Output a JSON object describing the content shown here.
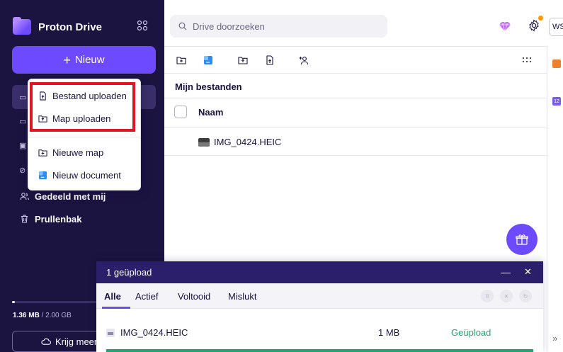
{
  "app": {
    "name": "Proton Drive"
  },
  "sidebar": {
    "new_button_label": "Nieuw",
    "shared_with_me_label": "Gedeeld met mij",
    "trash_label": "Prullenbak",
    "storage": {
      "used": "1.36 MB",
      "separator": " / ",
      "total": "2.00 GB",
      "fraction_used": 0.001
    },
    "get_more_label": "Krijg meer"
  },
  "search": {
    "placeholder": "Drive doorzoeken"
  },
  "user": {
    "initials": "WS"
  },
  "files": {
    "section_title": "Mijn bestanden",
    "column_name": "Naam",
    "items": [
      {
        "name": "IMG_0424.HEIC"
      }
    ]
  },
  "new_menu": {
    "items": [
      {
        "label": "Bestand uploaden"
      },
      {
        "label": "Map uploaden"
      },
      {
        "label": "Nieuwe map"
      },
      {
        "label": "Nieuw document"
      }
    ]
  },
  "upload_panel": {
    "header_title": "1 geüpload",
    "tabs": [
      {
        "label": "Alle"
      },
      {
        "label": "Actief"
      },
      {
        "label": "Voltooid"
      },
      {
        "label": "Mislukt"
      }
    ],
    "rows": [
      {
        "name": "IMG_0424.HEIC",
        "size": "1 MB",
        "status": "Geüpload",
        "progress": 1.0
      }
    ]
  },
  "colors": {
    "sidebar_bg": "#1b1340",
    "accent": "#6d4aff",
    "highlight_outline": "#e3141f",
    "success": "#1ea672"
  }
}
